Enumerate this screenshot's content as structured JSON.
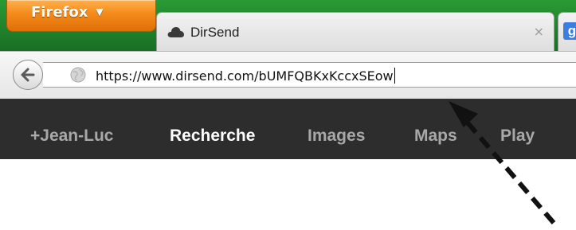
{
  "browser": {
    "menu_button_label": "Firefox",
    "menu_caret": "▼"
  },
  "tabs": [
    {
      "title": "DirSend",
      "close": "×",
      "favicon": "cloud-icon"
    },
    {
      "title": "",
      "favicon": "google-icon",
      "favicon_letter": "g"
    }
  ],
  "navigation": {
    "url": "https://www.dirsend.com/bUMFQBKxKccxSEow"
  },
  "google_bar": {
    "items": [
      "+Jean-Luc",
      "Recherche",
      "Images",
      "Maps",
      "Play"
    ],
    "active_item": "Recherche"
  },
  "colors": {
    "tabbar_green": "#1f7f2a",
    "firefox_orange": "#f48a1a",
    "google_bar_bg": "#2d2d2d",
    "google_blue": "#3b7de0"
  }
}
